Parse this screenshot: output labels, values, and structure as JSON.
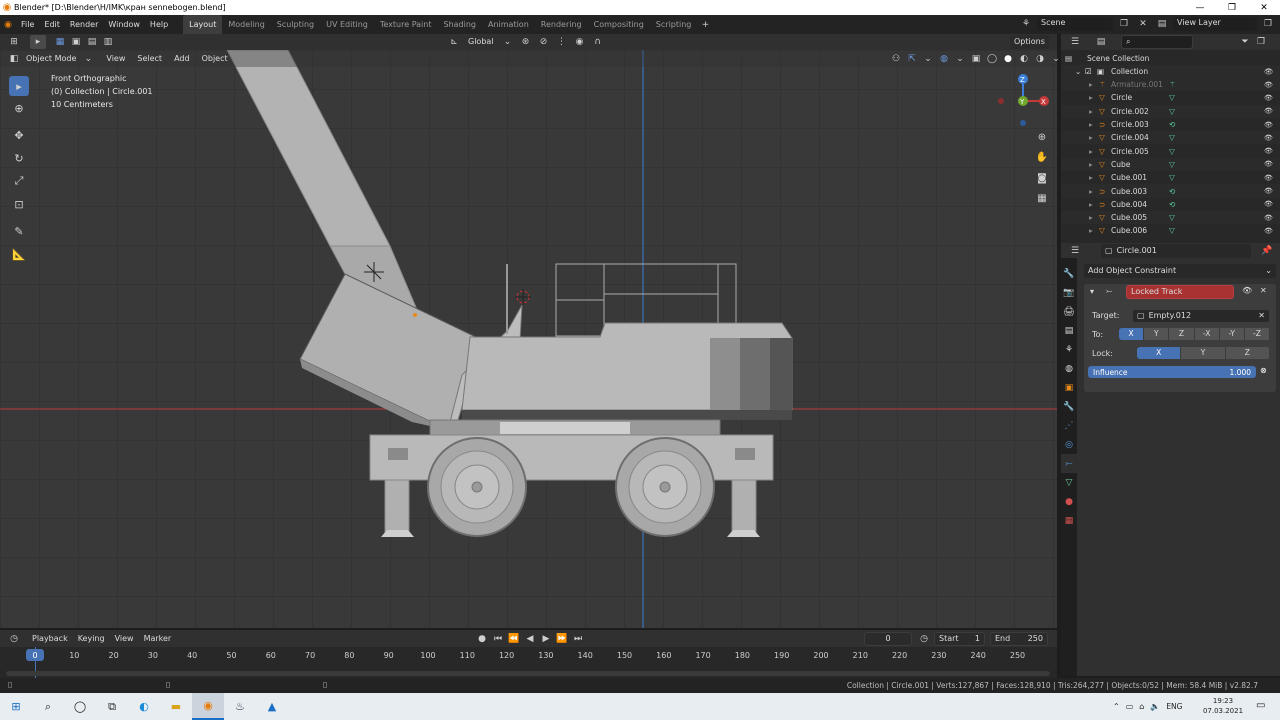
{
  "window": {
    "title": "Blender* [D:\\Blender\\H/IMK\\кран sennebogen.blend]"
  },
  "menu": [
    "File",
    "Edit",
    "Render",
    "Window",
    "Help"
  ],
  "workspaces": [
    {
      "label": "Layout",
      "active": true
    },
    {
      "label": "Modeling"
    },
    {
      "label": "Sculpting"
    },
    {
      "label": "UV Editing"
    },
    {
      "label": "Texture Paint"
    },
    {
      "label": "Shading"
    },
    {
      "label": "Animation"
    },
    {
      "label": "Rendering"
    },
    {
      "label": "Compositing"
    },
    {
      "label": "Scripting"
    }
  ],
  "scene": {
    "name": "Scene",
    "view_layer": "View Layer"
  },
  "tool_header": {
    "orientation": "Global",
    "options": "Options"
  },
  "viewport_header": {
    "mode": "Object Mode",
    "view": "View",
    "select": "Select",
    "add": "Add",
    "object": "Object"
  },
  "viewport_info": {
    "view_name": "Front Orthographic",
    "collection_line": "(0) Collection | Circle.001",
    "scale": "10 Centimeters"
  },
  "outliner": {
    "root": "Scene Collection",
    "collection": "Collection",
    "items": [
      {
        "name": "Armature.001",
        "icon": "armature-icon",
        "dim": true
      },
      {
        "name": "Circle",
        "icon": "mesh-icon"
      },
      {
        "name": "Circle.002",
        "icon": "mesh-icon"
      },
      {
        "name": "Circle.003",
        "icon": "curve-icon"
      },
      {
        "name": "Circle.004",
        "icon": "mesh-icon"
      },
      {
        "name": "Circle.005",
        "icon": "mesh-icon"
      },
      {
        "name": "Cube",
        "icon": "mesh-icon"
      },
      {
        "name": "Cube.001",
        "icon": "mesh-icon"
      },
      {
        "name": "Cube.003",
        "icon": "curve-icon"
      },
      {
        "name": "Cube.004",
        "icon": "curve-icon"
      },
      {
        "name": "Cube.005",
        "icon": "mesh-icon"
      },
      {
        "name": "Cube.006",
        "icon": "mesh-icon"
      }
    ]
  },
  "properties": {
    "object_name": "Circle.001",
    "add_constraint": "Add Object Constraint",
    "constraint": {
      "name": "Locked Track",
      "target_label": "Target:",
      "target_value": "Empty.012",
      "to_label": "To:",
      "to_axes": [
        {
          "label": "X",
          "on": true
        },
        {
          "label": "Y"
        },
        {
          "label": "Z"
        },
        {
          "label": "-X"
        },
        {
          "label": "-Y"
        },
        {
          "label": "-Z"
        }
      ],
      "lock_label": "Lock:",
      "lock_axes": [
        {
          "label": "X",
          "on": true
        },
        {
          "label": "Y"
        },
        {
          "label": "Z"
        }
      ],
      "influence_label": "Influence",
      "influence_value": "1.000"
    }
  },
  "timeline": {
    "playback": "Playback",
    "keying": "Keying",
    "view": "View",
    "marker": "Marker",
    "current_frame": "0",
    "start_label": "Start",
    "start": "1",
    "end_label": "End",
    "end": "250",
    "ticks": [
      "0",
      "10",
      "20",
      "30",
      "40",
      "50",
      "60",
      "70",
      "80",
      "90",
      "100",
      "110",
      "120",
      "130",
      "140",
      "150",
      "160",
      "170",
      "180",
      "190",
      "200",
      "210",
      "220",
      "230",
      "240",
      "250"
    ]
  },
  "status": {
    "text": "Collection | Circle.001 | Verts:127,867 | Faces:128,910 | Tris:264,277 | Objects:0/52 | Mem: 58.4 MiB | v2.82.7"
  },
  "taskbar": {
    "lang": "ENG",
    "time": "19:23",
    "date": "07.03.2021"
  },
  "colors": {
    "accent": "#4772b3",
    "constraint_error": "#a83232",
    "active_tab": "#3d3d3d",
    "x_axis": "#c43a3a",
    "y_axis": "#6fa82d",
    "z_axis": "#3b7fd9"
  }
}
